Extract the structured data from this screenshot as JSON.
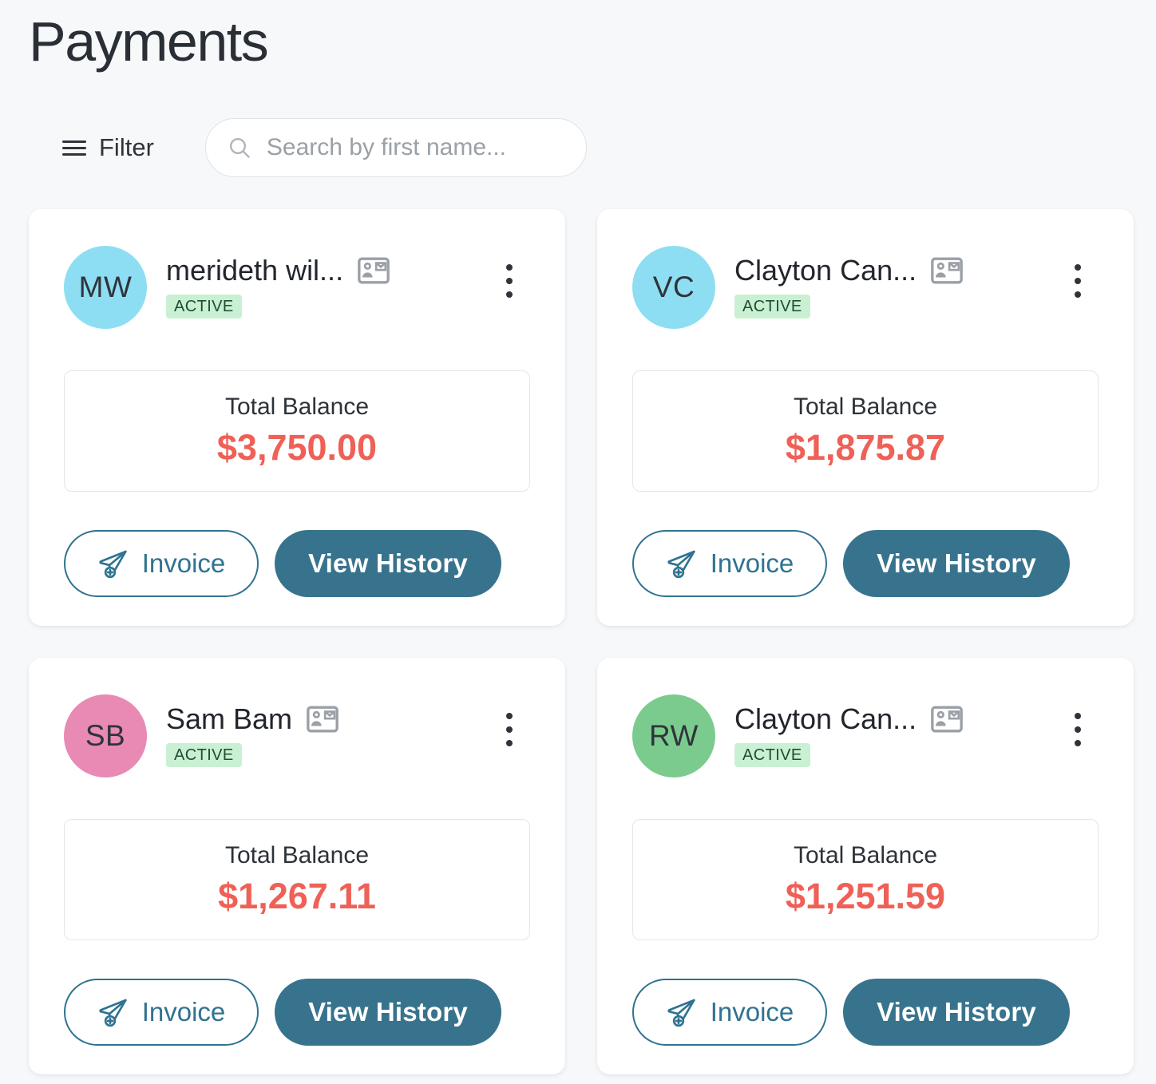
{
  "header": {
    "title": "Payments",
    "filter_label": "Filter",
    "filter_icon": "hamburger-icon",
    "search_icon": "search-icon",
    "search_value": "",
    "search_placeholder": "Search by first name..."
  },
  "labels": {
    "balance_label": "Total Balance",
    "invoice_label": "Invoice",
    "history_label": "View History",
    "status_active": "ACTIVE",
    "contact_icon": "contact-card-icon",
    "invoice_icon": "paper-plane-plus-icon",
    "kebab_icon": "more-vertical-icon"
  },
  "colors": {
    "page_background": "#f7f8fa",
    "card_background": "#ffffff",
    "amount": "#ef6056",
    "primary_button": "#38738e",
    "outline_button": "#2f7391",
    "badge_background": "#c9f0d2",
    "badge_text": "#1f4d33"
  },
  "cards": [
    {
      "initials": "MW",
      "avatar_color": "#8ddef2",
      "name": "merideth wil...",
      "status": "ACTIVE",
      "balance_label": "Total Balance",
      "balance": "$3,750.00",
      "invoice_label": "Invoice",
      "history_label": "View History"
    },
    {
      "initials": "VC",
      "avatar_color": "#8ddef2",
      "name": "Clayton Can...",
      "status": "ACTIVE",
      "balance_label": "Total Balance",
      "balance": "$1,875.87",
      "invoice_label": "Invoice",
      "history_label": "View History"
    },
    {
      "initials": "SB",
      "avatar_color": "#e88ab4",
      "name": "Sam Bam",
      "status": "ACTIVE",
      "balance_label": "Total Balance",
      "balance": "$1,267.11",
      "invoice_label": "Invoice",
      "history_label": "View History"
    },
    {
      "initials": "RW",
      "avatar_color": "#7ccb8e",
      "name": "Clayton Can...",
      "status": "ACTIVE",
      "balance_label": "Total Balance",
      "balance": "$1,251.59",
      "invoice_label": "Invoice",
      "history_label": "View History"
    }
  ]
}
